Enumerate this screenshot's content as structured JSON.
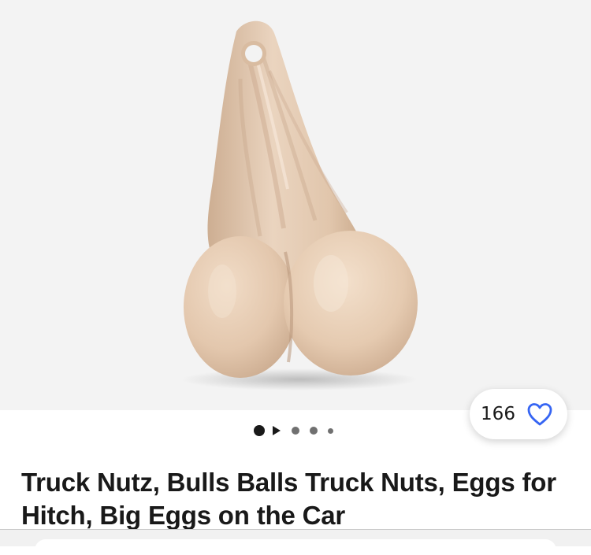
{
  "listing": {
    "title": "Truck Nutz, Bulls Balls Truck Nuts, Eggs for Hitch, Big Eggs on the Car",
    "watch_count": "166"
  },
  "gallery": {
    "image": "product-photo",
    "background_color": "#f3f3f3",
    "dots": [
      "active-dot",
      "video-play",
      "dot",
      "dot",
      "dot-small"
    ]
  },
  "colors": {
    "accent": "#3665f3",
    "text": "#191919",
    "product": "#e2c7ae"
  },
  "icons": {
    "watch": "heart-icon",
    "video": "play-icon"
  }
}
